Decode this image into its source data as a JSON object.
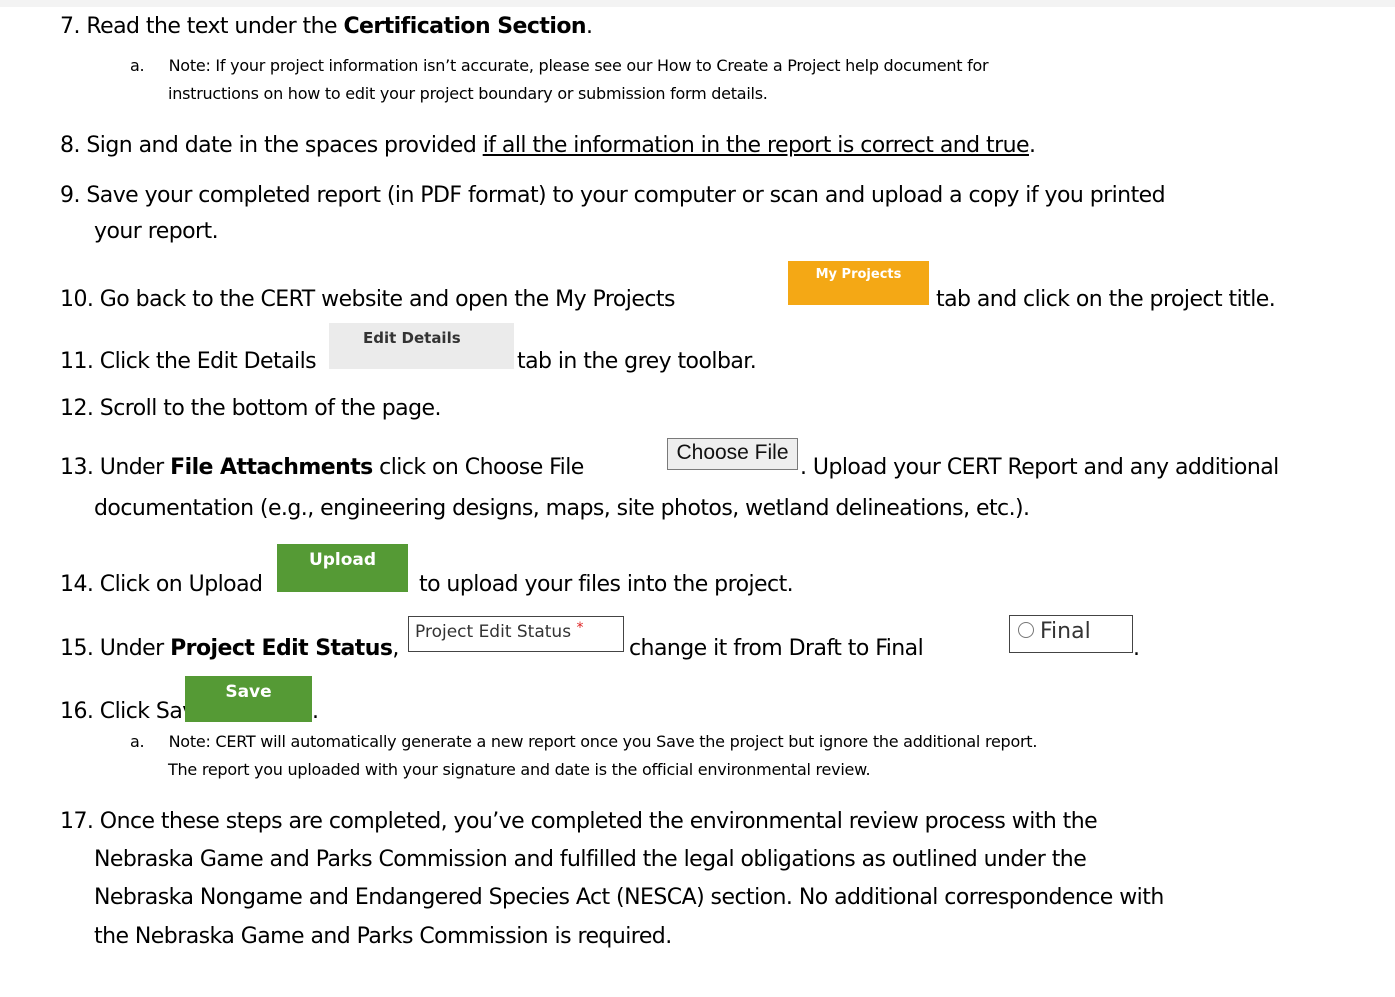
{
  "steps": [
    {
      "num": "7.",
      "pre": "Read the text under the ",
      "bold": "Certification Section",
      "post": "."
    },
    {
      "num": "8.",
      "pre": "Sign and date in the spaces provided ",
      "underline": "if all the information in the report is correct and true",
      "post": "."
    },
    {
      "num": "9.",
      "line1": "Save your completed report (in PDF format) to your computer or scan and upload a copy if you printed",
      "line2": "your report."
    },
    {
      "num": "10.",
      "pre": "Go back to the CERT website and open the My Projects ",
      "post": "tab and click on the project title."
    },
    {
      "num": "11.",
      "pre": "Click the Edit Details ",
      "post": "tab in the grey toolbar."
    },
    {
      "num": "12.",
      "text": "Scroll to the bottom of the page."
    },
    {
      "num": "13.",
      "pre": "Under ",
      "bold": "File Attachments",
      "mid": " click on Choose File ",
      "post": ". Upload your CERT Report and any additional",
      "line2": "documentation (e.g., engineering designs, maps, site photos, wetland delineations, etc.)."
    },
    {
      "num": "14.",
      "pre": " Click on Upload ",
      "post": "to upload your files into the project."
    },
    {
      "num": "15.",
      "pre": "Under ",
      "bold": "Project Edit Status",
      "mid": ", ",
      "mid2": "change it from Draft to Final ",
      "post": "."
    },
    {
      "num": "16.",
      "pre": "Click Save ",
      "post": "."
    },
    {
      "num": "17.",
      "line1": "Once these steps are completed, you’ve completed the environmental review process with the",
      "line2": "Nebraska Game and Parks Commission and fulfilled the legal obligations as outlined under the",
      "line3": "Nebraska Nongame and Endangered Species Act (NESCA) section. No additional correspondence with",
      "line4": "the Nebraska Game and Parks Commission is required."
    }
  ],
  "notes": {
    "note7": {
      "letter": "a.",
      "line1": "Note: If your project information isn’t accurate, please see our How to Create a Project help document for",
      "line2": "instructions on how to edit your project boundary or submission form details."
    },
    "note16": {
      "letter": "a.",
      "line1": "Note: CERT will automatically generate a new report once you Save the project but ignore the additional report.",
      "line2": "The report you uploaded with your signature and date is the official environmental review."
    }
  },
  "widgets": {
    "my_projects": "My Projects",
    "edit_details": "Edit Details",
    "choose_file": "Choose File",
    "upload": "Upload",
    "project_edit_status": "Project Edit Status",
    "required_mark": "*",
    "final": "Final",
    "save": "Save"
  },
  "colors": {
    "orange": "#f4a815",
    "green": "#559a35",
    "grey_toolbar": "#ebebeb"
  }
}
